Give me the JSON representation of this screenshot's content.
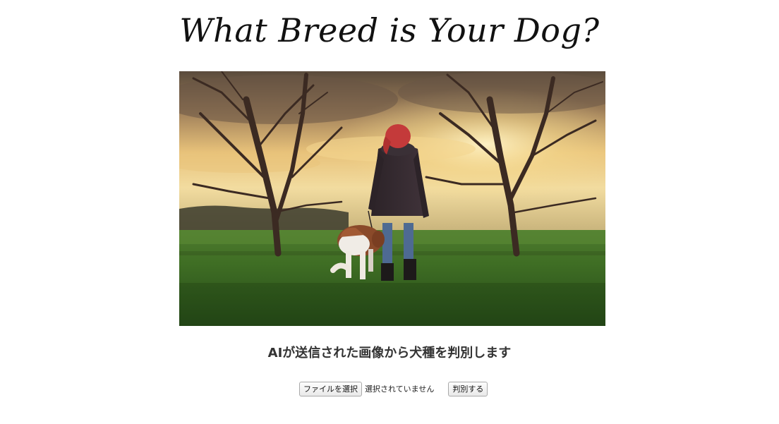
{
  "page": {
    "title": "What Breed is Your Dog?",
    "subtitle": "AIが送信された画像から犬種を判別します"
  },
  "hero_image": {
    "alt": "woman-walking-dog-at-sunset-photo"
  },
  "form": {
    "file_button_label": "ファイルを選択",
    "file_status": "選択されていません",
    "submit_label": "判別する"
  },
  "colors": {
    "title": "#111111",
    "subtitle": "#333333",
    "button_border": "#a9a9a9"
  }
}
